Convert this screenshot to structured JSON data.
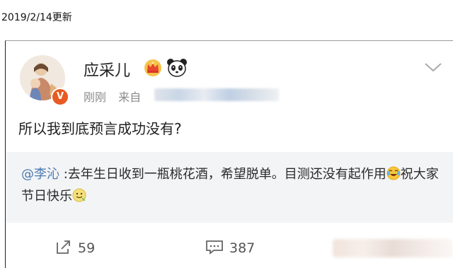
{
  "caption": "2019/2/14更新",
  "post": {
    "author": "应采儿",
    "verified_badge": "V",
    "timestamp": "刚刚",
    "source_prefix": "来自",
    "text": "所以我到底预言成功没有?",
    "icons": [
      "crown-icon",
      "panda-icon",
      "chevron-down-icon",
      "verified-icon"
    ]
  },
  "repost": {
    "mention": "@李沁",
    "text_part1": " :去年生日收到一瓶桃花酒，希望脱单。目测还没有起作用",
    "text_part2": "祝大家节日快乐",
    "icons": [
      "laughing-tears-emoji-icon",
      "smile-emoji-icon"
    ]
  },
  "actions": {
    "repost_count": "59",
    "comment_count": "387",
    "icons": [
      "share-icon",
      "comment-icon"
    ]
  },
  "colors": {
    "mention": "#4a78b4",
    "repost_bg": "#f3f4f5",
    "badge": "#e85a22",
    "meta_text": "#8a8a8a"
  }
}
